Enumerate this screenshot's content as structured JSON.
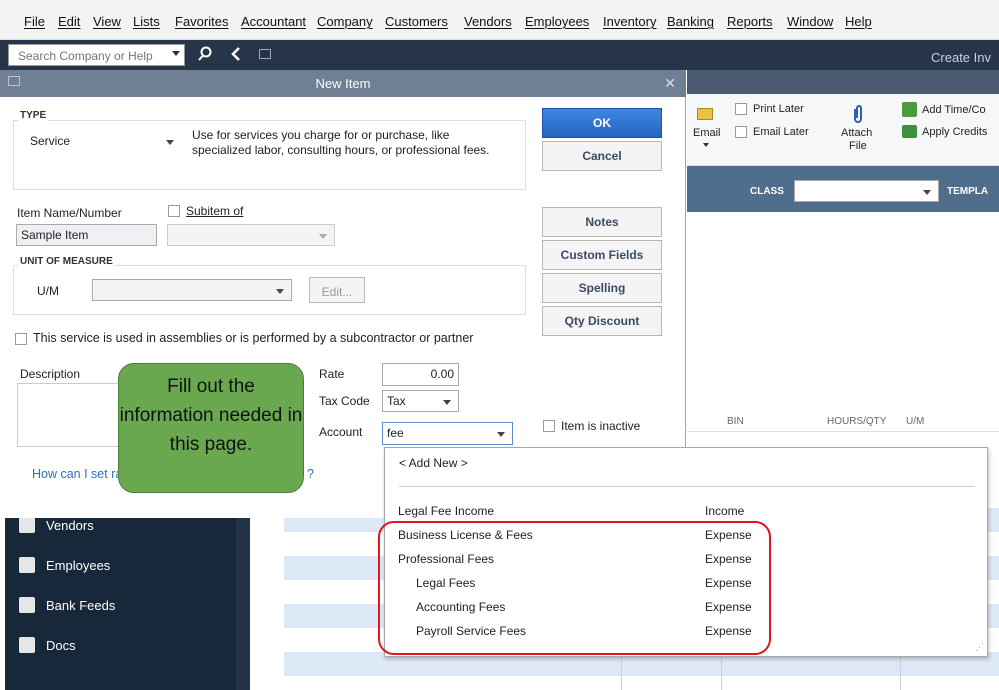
{
  "menu": [
    "File",
    "Edit",
    "View",
    "Lists",
    "Favorites",
    "Accountant",
    "Company",
    "Customers",
    "Vendors",
    "Employees",
    "Inventory",
    "Banking",
    "Reports",
    "Window",
    "Help"
  ],
  "search": {
    "placeholder": "Search Company or Help"
  },
  "background_window": {
    "title": "Create Inv"
  },
  "dialog": {
    "title": "New Item",
    "type_section": "TYPE",
    "type_value": "Service",
    "type_description": "Use for services you charge for or purchase, like specialized labor, consulting hours, or professional fees.",
    "item_name_label": "Item Name/Number",
    "item_name_value": "Sample Item",
    "subitem_label": "Subitem of",
    "uom_section": "UNIT OF MEASURE",
    "uom_label": "U/M",
    "edit_label": "Edit...",
    "assembly_label": "This service is used in assemblies or is performed by a subcontractor or partner",
    "description_label": "Description",
    "rate_label": "Rate",
    "rate_value": "0.00",
    "taxcode_label": "Tax Code",
    "taxcode_value": "Tax",
    "account_label": "Account",
    "account_value": "fee",
    "help_link_start": "How can I set ra",
    "help_link_end": "?",
    "inactive_label": "Item is inactive",
    "buttons": {
      "ok": "OK",
      "cancel": "Cancel",
      "notes": "Notes",
      "custom_fields": "Custom Fields",
      "spelling": "Spelling",
      "qty_discount": "Qty Discount"
    }
  },
  "right_panel": {
    "email": "Email",
    "print_later": "Print Later",
    "email_later": "Email Later",
    "attach_file_1": "Attach",
    "attach_file_2": "File",
    "add_time": "Add Time/Co",
    "apply_credits": "Apply Credits",
    "class_label": "CLASS",
    "template_label": "TEMPLA",
    "col_bin": "BIN",
    "col_hours": "HOURS/QTY",
    "col_um": "U/M"
  },
  "sidebar": {
    "items": [
      {
        "label": "Vendors"
      },
      {
        "label": "Employees"
      },
      {
        "label": "Bank Feeds"
      },
      {
        "label": "Docs"
      }
    ]
  },
  "account_dropdown": {
    "add_new": "< Add New >",
    "accounts": [
      {
        "name": "Legal Fee Income",
        "type": "Income"
      },
      {
        "name": "Business License & Fees",
        "type": "Expense"
      },
      {
        "name": "Professional Fees",
        "type": "Expense"
      },
      {
        "name": "Legal Fees",
        "type": "Expense"
      },
      {
        "name": "Accounting Fees",
        "type": "Expense"
      },
      {
        "name": "Payroll Service Fees",
        "type": "Expense"
      }
    ]
  },
  "callout": {
    "text": "Fill out the information needed in this page."
  },
  "colors": {
    "dialog_title": "#6f7f94",
    "ok_button": "#2f77d6",
    "callout": "#6aa84f",
    "highlight_ring": "#e3141d",
    "toolbar": "#27354a",
    "sidebar": "#18283b"
  }
}
